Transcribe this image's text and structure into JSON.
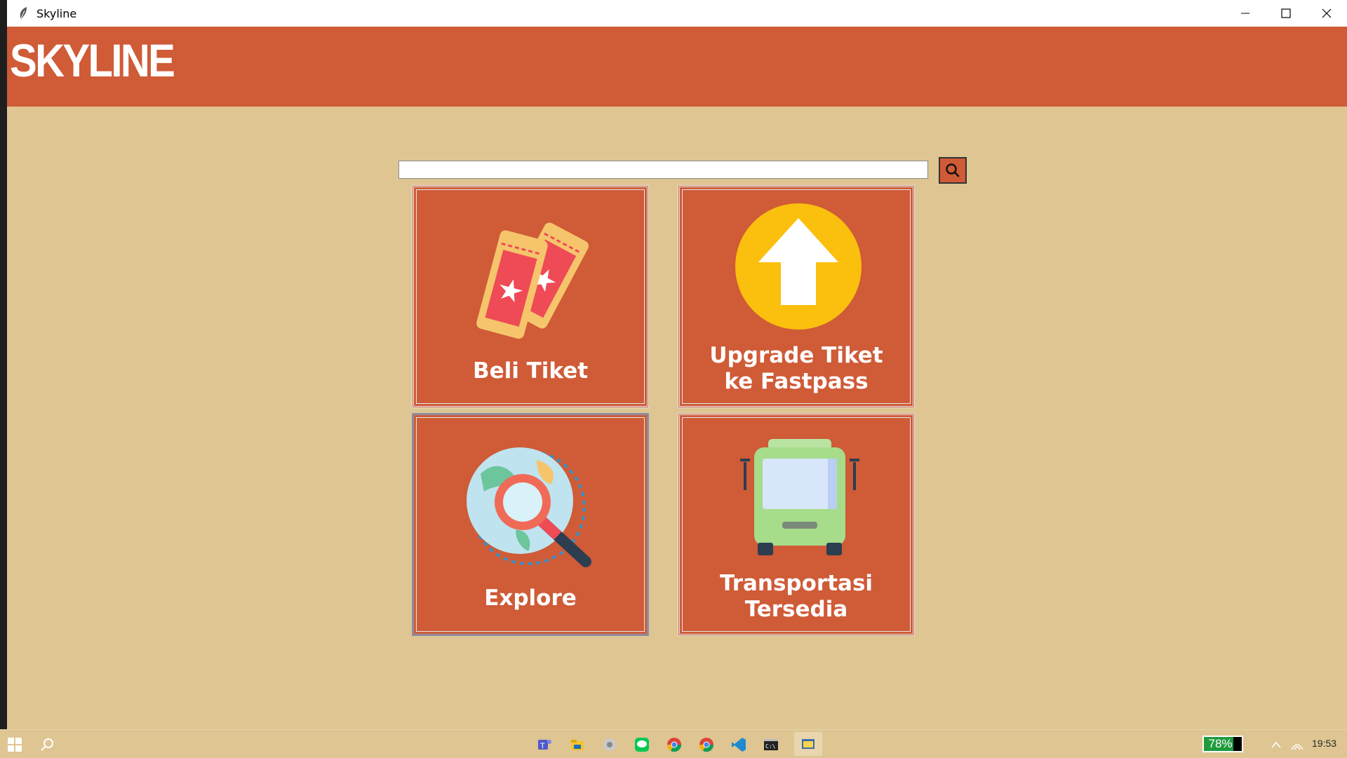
{
  "window": {
    "title": "Skyline"
  },
  "header": {
    "logo_text": "SKYLINE"
  },
  "search": {
    "value": "",
    "placeholder": ""
  },
  "tiles": [
    {
      "line1": "Beli Tiket",
      "line2": "",
      "icon": "tickets-icon"
    },
    {
      "line1": "Upgrade Tiket",
      "line2": "ke Fastpass",
      "icon": "upload-arrow-icon"
    },
    {
      "line1": "Explore",
      "line2": "",
      "icon": "globe-magnifier-icon"
    },
    {
      "line1": "Transportasi",
      "line2": "Tersedia",
      "icon": "bus-icon"
    }
  ],
  "taskbar": {
    "battery_percent": "78%",
    "battery_level": 0.78,
    "clock": "19:53"
  },
  "colors": {
    "header": "#cf5b37",
    "background": "#dec592",
    "tile": "#cf5b37"
  }
}
